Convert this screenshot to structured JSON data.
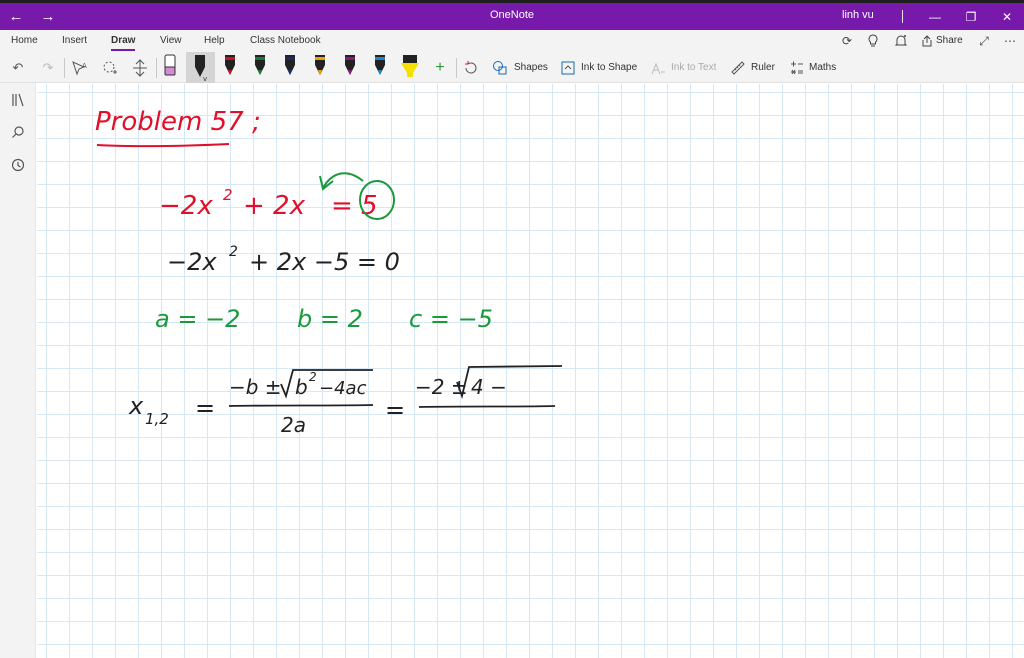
{
  "window": {
    "app_title": "OneNote",
    "user_name": "linh vu",
    "accent": "#7719aa"
  },
  "menu": {
    "tabs": [
      "Home",
      "Insert",
      "Draw",
      "View",
      "Help",
      "Class Notebook"
    ],
    "active_tab": "Draw",
    "share_label": "Share"
  },
  "ribbon": {
    "pen_colors": [
      "#000000",
      "#cc1122",
      "#1a7a3a",
      "#1a2a6a",
      "#e8a400",
      "#8a1a7a",
      "#1a8acc",
      "#f5e000"
    ],
    "shapes_label": "Shapes",
    "ink_to_shape_label": "Ink to Shape",
    "ink_to_text_label": "Ink to Text",
    "ruler_label": "Ruler",
    "maths_label": "Maths"
  },
  "ink": {
    "title": "Problem 57 ;",
    "line1_a": "−2x",
    "line1_exp": "2",
    "line1_b": "+ 2x",
    "line1_c": "= 5",
    "line2_a": "−2x",
    "line2_exp": "2",
    "line2_b": "+ 2x −5 = 0",
    "coef_a": "a = −2",
    "coef_b": "b = 2",
    "coef_c": "c = −5",
    "x_label": "x",
    "x_sub": "1,2",
    "eq1": "=",
    "num1": "−b ±",
    "rad1": "b",
    "rad1_exp": "2",
    "rad1_rest": "−4ac",
    "den1": "2a",
    "eq2": "=",
    "num2": "−2 ±",
    "rad2": "4 −",
    "colors": {
      "red": "#e0102a",
      "green": "#1a9a3a",
      "black": "#222222"
    }
  }
}
